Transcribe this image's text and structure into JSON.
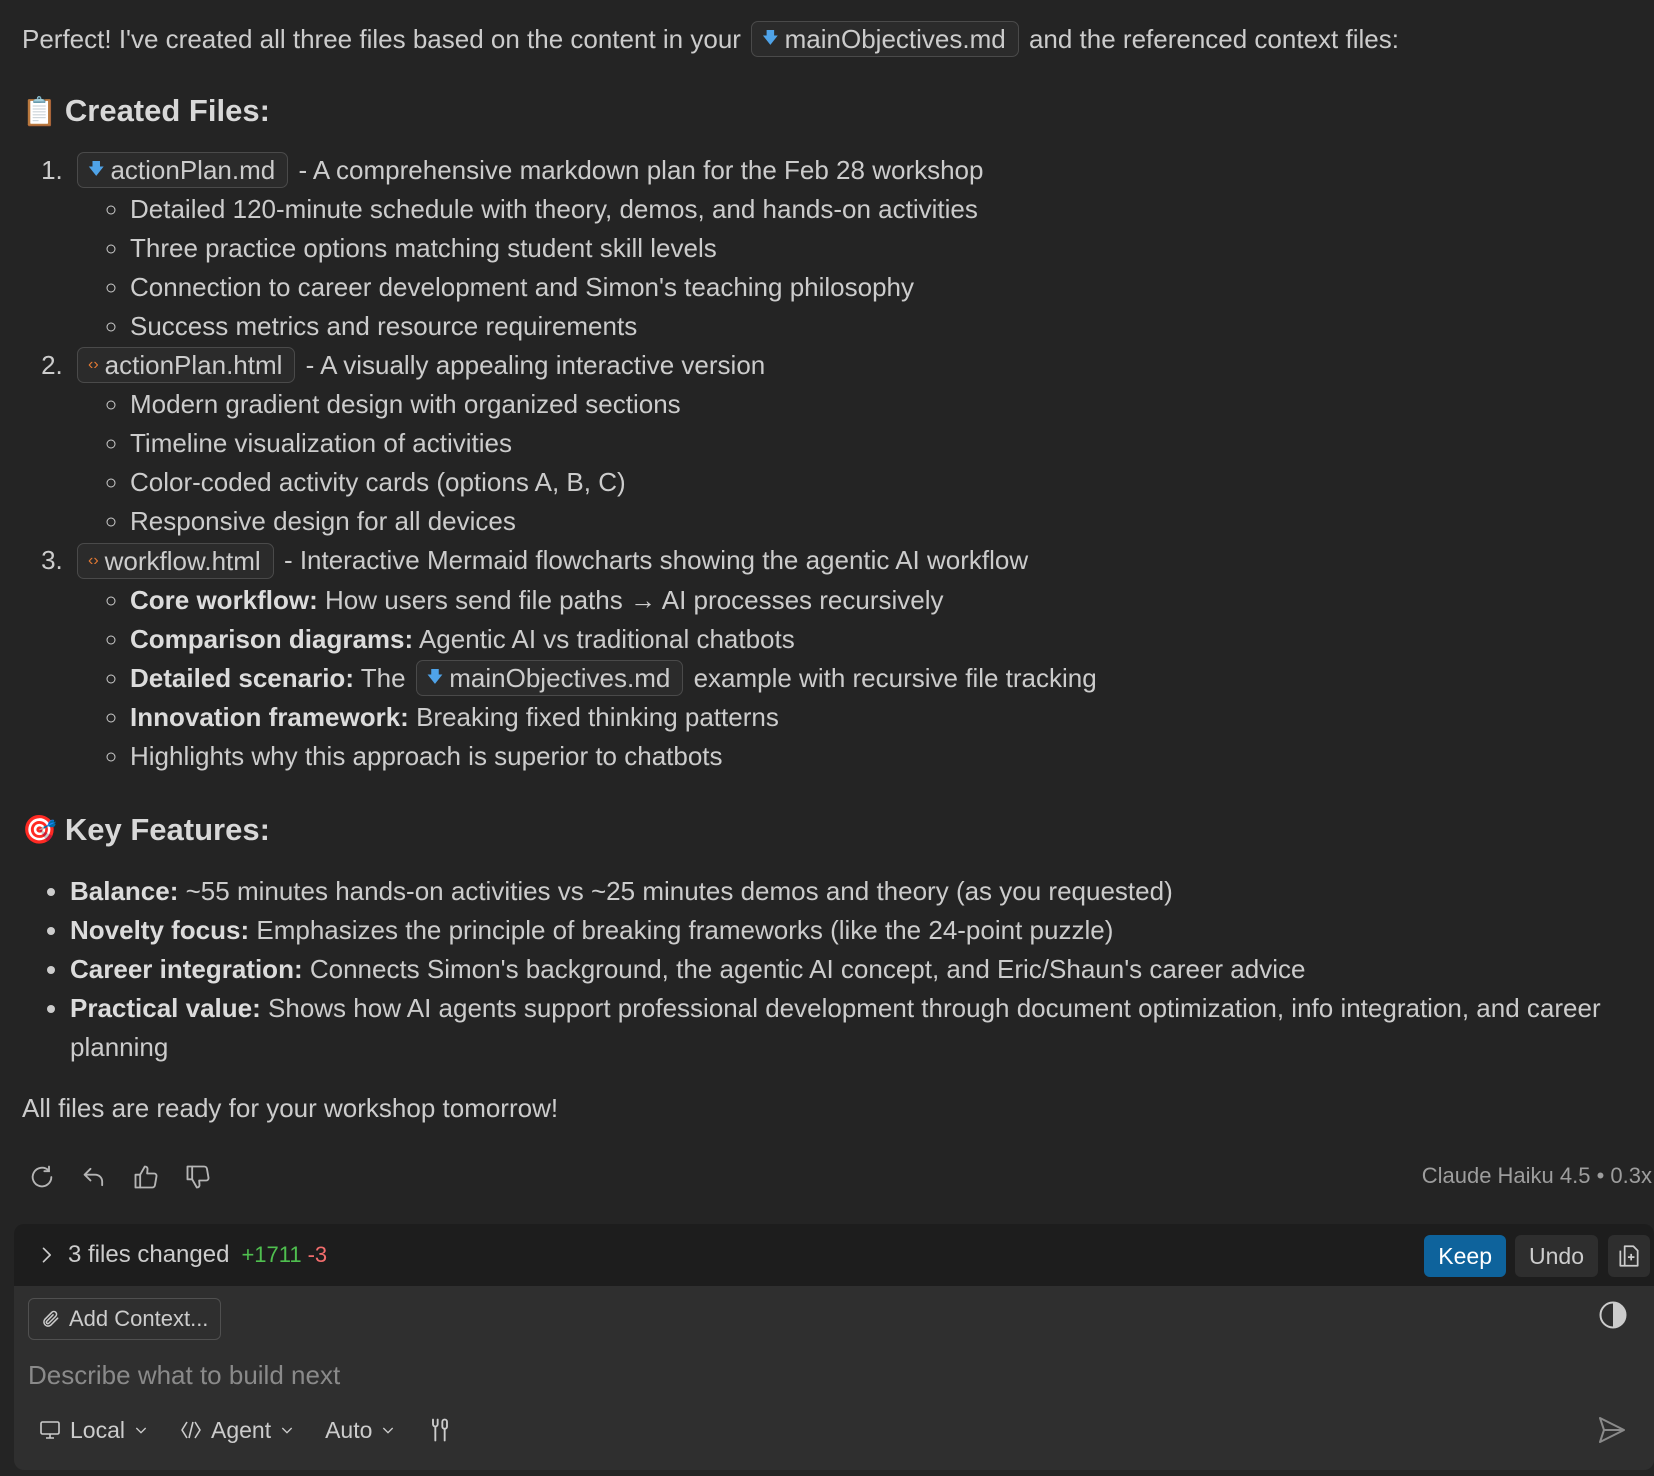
{
  "intro": {
    "before": "Perfect! I've created all three files based on the content in your",
    "file": "mainObjectives.md",
    "after": "and the referenced context files:"
  },
  "created_heading": {
    "emoji": "📋",
    "text": "Created Files:"
  },
  "files": [
    {
      "number": "1.",
      "name": "actionPlan.md",
      "icon": "markdown-file-icon",
      "desc": "- A comprehensive markdown plan for the Feb 28 workshop",
      "bullets": [
        "Detailed 120-minute schedule with theory, demos, and hands-on activities",
        "Three practice options matching student skill levels",
        "Connection to career development and Simon's teaching philosophy",
        "Success metrics and resource requirements"
      ]
    },
    {
      "number": "2.",
      "name": "actionPlan.html",
      "icon": "html-file-icon",
      "desc": "- A visually appealing interactive version",
      "bullets": [
        "Modern gradient design with organized sections",
        "Timeline visualization of activities",
        "Color-coded activity cards (options A, B, C)",
        "Responsive design for all devices"
      ]
    },
    {
      "number": "3.",
      "name": "workflow.html",
      "icon": "html-file-icon",
      "desc": "- Interactive Mermaid flowcharts showing the agentic AI workflow",
      "bullets": [
        {
          "bold": "Core workflow:",
          "text": "How users send file paths → AI processes recursively"
        },
        {
          "bold": "Comparison diagrams:",
          "text": "Agentic AI vs traditional chatbots"
        },
        {
          "bold": "Detailed scenario:",
          "pre": "The",
          "file": "mainObjectives.md",
          "text": "example with recursive file tracking"
        },
        {
          "bold": "Innovation framework:",
          "text": "Breaking fixed thinking patterns"
        },
        {
          "text": "Highlights why this approach is superior to chatbots"
        }
      ]
    }
  ],
  "features_heading": {
    "emoji": "🎯",
    "text": "Key Features:"
  },
  "features": [
    {
      "bold": "Balance:",
      "text": "~55 minutes hands-on activities vs ~25 minutes demos and theory (as you requested)"
    },
    {
      "bold": "Novelty focus:",
      "text": "Emphasizes the principle of breaking frameworks (like the 24-point puzzle)"
    },
    {
      "bold": "Career integration:",
      "text": "Connects Simon's background, the agentic AI concept, and Eric/Shaun's career advice"
    },
    {
      "bold": "Practical value:",
      "text": "Shows how AI agents support professional development through document optimization, info integration, and career planning"
    }
  ],
  "closing": "All files are ready for your workshop tomorrow!",
  "model_info": "Claude Haiku 4.5 • 0.3x",
  "changes": {
    "label": "3 files changed",
    "added": "+1711",
    "removed": "-3",
    "keep": "Keep",
    "undo": "Undo"
  },
  "input": {
    "add_context": "Add Context...",
    "placeholder": "Describe what to build next",
    "location": "Local",
    "mode": "Agent",
    "model": "Auto"
  }
}
